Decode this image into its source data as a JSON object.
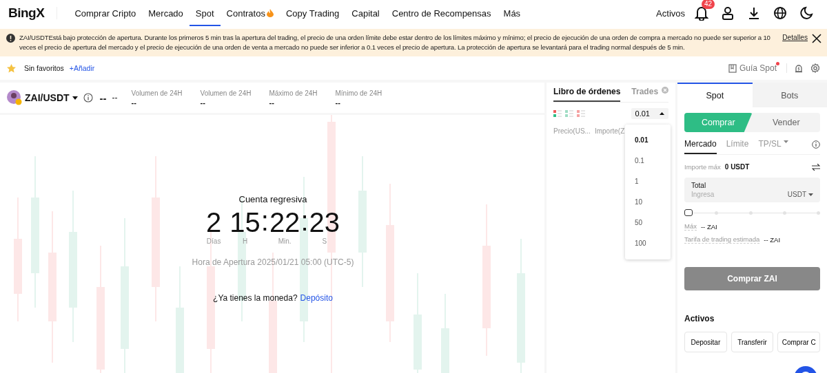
{
  "header": {
    "logo": "BingX",
    "nav": [
      {
        "label": "Comprar Cripto",
        "selected": false,
        "hot": false
      },
      {
        "label": "Mercado",
        "selected": false,
        "hot": false
      },
      {
        "label": "Spot",
        "selected": true,
        "hot": false
      },
      {
        "label": "Contratos",
        "selected": false,
        "hot": true
      },
      {
        "label": "Copy Trading",
        "selected": false,
        "hot": false
      },
      {
        "label": "Capital",
        "selected": false,
        "hot": false
      },
      {
        "label": "Centro de Recompensas",
        "selected": false,
        "hot": false
      },
      {
        "label": "Más",
        "selected": false,
        "hot": false
      }
    ],
    "assets_link": "Activos",
    "notification_count": "42"
  },
  "banner": {
    "text": "ZAI/USDTEstá bajo protección de apertura. Durante los primeros 5 min tras la apertura del trading, el precio de una orden límite debe estar dentro de los límites máximo y mínimo; el precio de ejecución de una orden de compra a mercado no puede ser superior a 10 veces el precio de apertura del mercado y el precio de ejecución de una orden de venta a mercado no puede ser inferior a 0.1 veces el precio de apertura. La protección de apertura se levantará para el trading normal después de 5 min.",
    "link": "Detalles"
  },
  "favorites": {
    "empty_text": "Sin favoritos",
    "add_link": "+Añadir",
    "guide": "Guía Spot",
    "guide_new": true
  },
  "ticker": {
    "pair": "ZAI/USDT",
    "price": "--",
    "change": "--",
    "stats": [
      {
        "label": "Volumen de 24H",
        "value": "--"
      },
      {
        "label": "Volumen de 24H",
        "value": "--"
      },
      {
        "label": "Máximo de 24H",
        "value": "--"
      },
      {
        "label": "Mínimo de 24H",
        "value": "--"
      }
    ]
  },
  "countdown": {
    "title": "Cuenta regresiva",
    "segments": [
      {
        "value": "2",
        "unit": "Días"
      },
      {
        "value": "15",
        "unit": "H"
      },
      {
        "value": "22",
        "unit": "Min.",
        "separator": ":"
      },
      {
        "value": "23",
        "unit": "S",
        "separator": ":"
      }
    ],
    "open_time": "Hora de Apertura 2025/01/21 05:00 (UTC-5)",
    "prompt": "¿Ya tienes la moneda?",
    "deposit_link": "Depósito"
  },
  "order_book": {
    "tabs": [
      {
        "label": "Libro de órdenes",
        "selected": true
      },
      {
        "label": "Trades",
        "selected": false
      }
    ],
    "precision": "0.01",
    "precision_open": true,
    "precision_options": [
      {
        "label": "0.01",
        "selected": true
      },
      {
        "label": "0.1",
        "selected": false
      },
      {
        "label": "1",
        "selected": false
      },
      {
        "label": "10",
        "selected": false
      },
      {
        "label": "50",
        "selected": false
      },
      {
        "label": "100",
        "selected": false
      }
    ],
    "columns": [
      "Precio(US...",
      "Importe(Z"
    ]
  },
  "trade_panel": {
    "tabs": [
      {
        "label": "Spot",
        "selected": true
      },
      {
        "label": "Bots",
        "selected": false
      }
    ],
    "sides": [
      {
        "label": "Comprar",
        "selected": true
      },
      {
        "label": "Vender",
        "selected": false
      }
    ],
    "order_types": [
      {
        "label": "Mercado",
        "selected": true,
        "dropdown": false
      },
      {
        "label": "Límite",
        "selected": false,
        "dropdown": false
      },
      {
        "label": "TP/SL",
        "selected": false,
        "dropdown": true
      }
    ],
    "max_amount_label": "Importe máx",
    "max_amount": "0 USDT",
    "total": {
      "label": "Total",
      "placeholder": "Ingresa",
      "unit": "USDT"
    },
    "slider": {
      "level": 0
    },
    "max_label": "Máx",
    "max_value": "-- ZAI",
    "fee_label": "Tarifa de trading estimada",
    "fee_value": "-- ZAI",
    "submit": {
      "label": "Comprar ZAI",
      "disabled": true
    },
    "assets_title": "Activos",
    "asset_buttons": [
      "Depositar",
      "Transferir",
      "Comprar C"
    ]
  }
}
